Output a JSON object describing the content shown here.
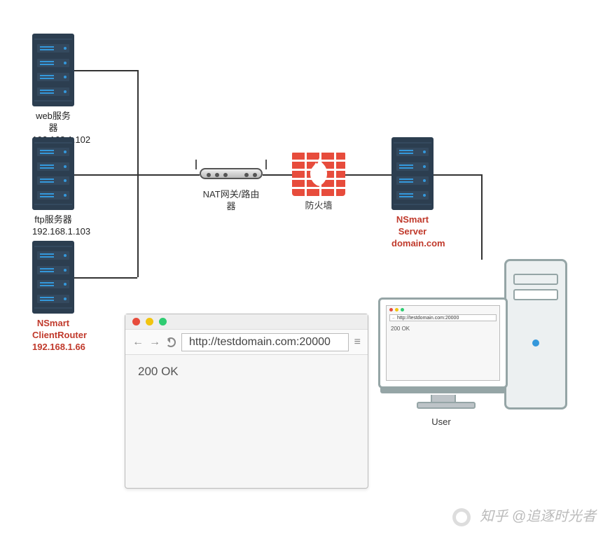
{
  "servers": {
    "web": {
      "name": "web服务器",
      "ip": "192.168.1.102"
    },
    "ftp": {
      "name": "ftp服务器",
      "ip": "192.168.1.103"
    },
    "client": {
      "name": "NSmart",
      "sub": "ClientRouter",
      "ip": "192.168.1.66"
    },
    "nsmart": {
      "name": "NSmart",
      "sub": "Server",
      "host": "domain.com"
    }
  },
  "router": {
    "label": "NAT网关/路由器"
  },
  "firewall": {
    "label": "防火墙"
  },
  "user": {
    "label": "User"
  },
  "browser": {
    "url": "http://testdomain.com:20000",
    "body": "200 OK"
  },
  "mini_browser": {
    "url": "http://testdomain.com:20000",
    "body": "200 OK"
  },
  "watermark": {
    "text": "知乎 @追逐时光者"
  }
}
